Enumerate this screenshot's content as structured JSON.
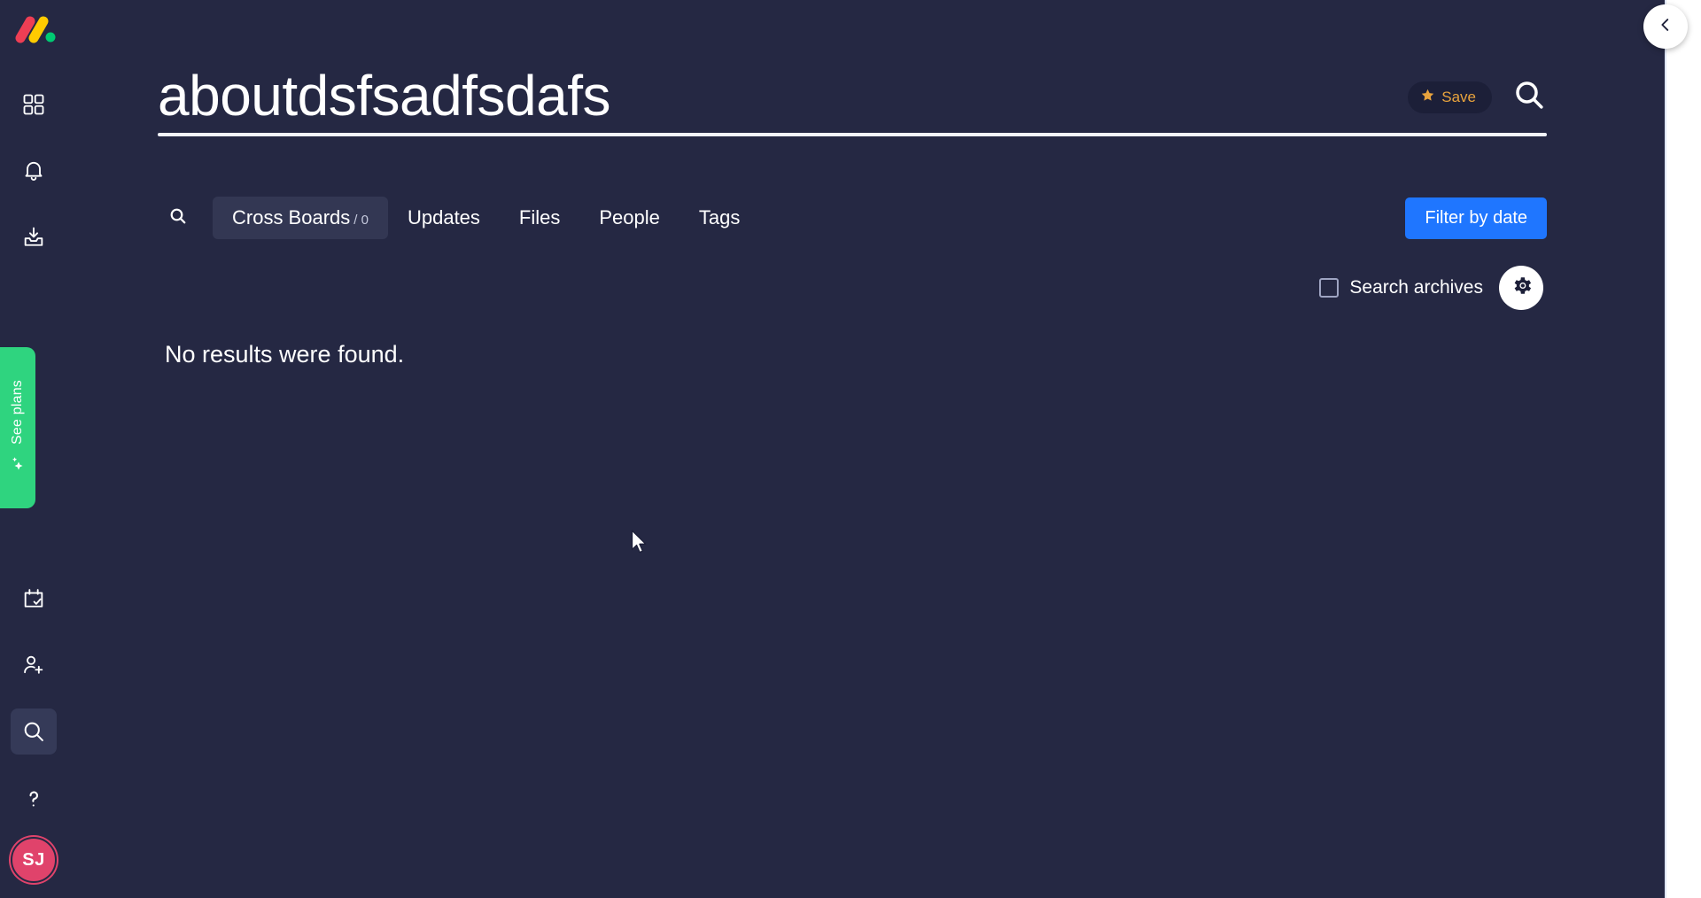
{
  "app": {
    "brand": "monday-logo",
    "panel_bg": "#252843",
    "accent_blue": "#1f76ff",
    "accent_green": "#2fd47f",
    "accent_orange": "#e8a33d",
    "avatar_color": "#e0436b"
  },
  "rail": {
    "items": [
      {
        "name": "dashboard-grid-icon",
        "label": "Dashboard"
      },
      {
        "name": "notifications-bell-icon",
        "label": "Notifications"
      },
      {
        "name": "inbox-icon",
        "label": "Inbox"
      },
      {
        "name": "my-work-calendar-icon",
        "label": "My work"
      },
      {
        "name": "invite-member-icon",
        "label": "Invite members"
      },
      {
        "name": "search-everything-icon",
        "label": "Search everything"
      },
      {
        "name": "help-question-icon",
        "label": "Help"
      }
    ],
    "avatar_initials": "SJ"
  },
  "promo": {
    "label": "See plans",
    "icon": "sparkles-icon"
  },
  "collapse": {
    "icon": "chevron-left-icon",
    "label": "Collapse panel"
  },
  "header": {
    "title": "aboutdsfsadfsdafs",
    "save_label": "Save",
    "save_icon": "star-icon",
    "search_icon": "search-icon"
  },
  "tabs": {
    "search_icon": "search-icon",
    "items": [
      {
        "label": "Cross Boards",
        "count": "/ 0",
        "active": true
      },
      {
        "label": "Updates",
        "count": "",
        "active": false
      },
      {
        "label": "Files",
        "count": "",
        "active": false
      },
      {
        "label": "People",
        "count": "",
        "active": false
      },
      {
        "label": "Tags",
        "count": "",
        "active": false
      }
    ],
    "filter_label": "Filter by date"
  },
  "options": {
    "archives_label": "Search archives",
    "archives_checked": false,
    "settings_icon": "gear-icon"
  },
  "results": {
    "empty_message": "No results were found."
  }
}
